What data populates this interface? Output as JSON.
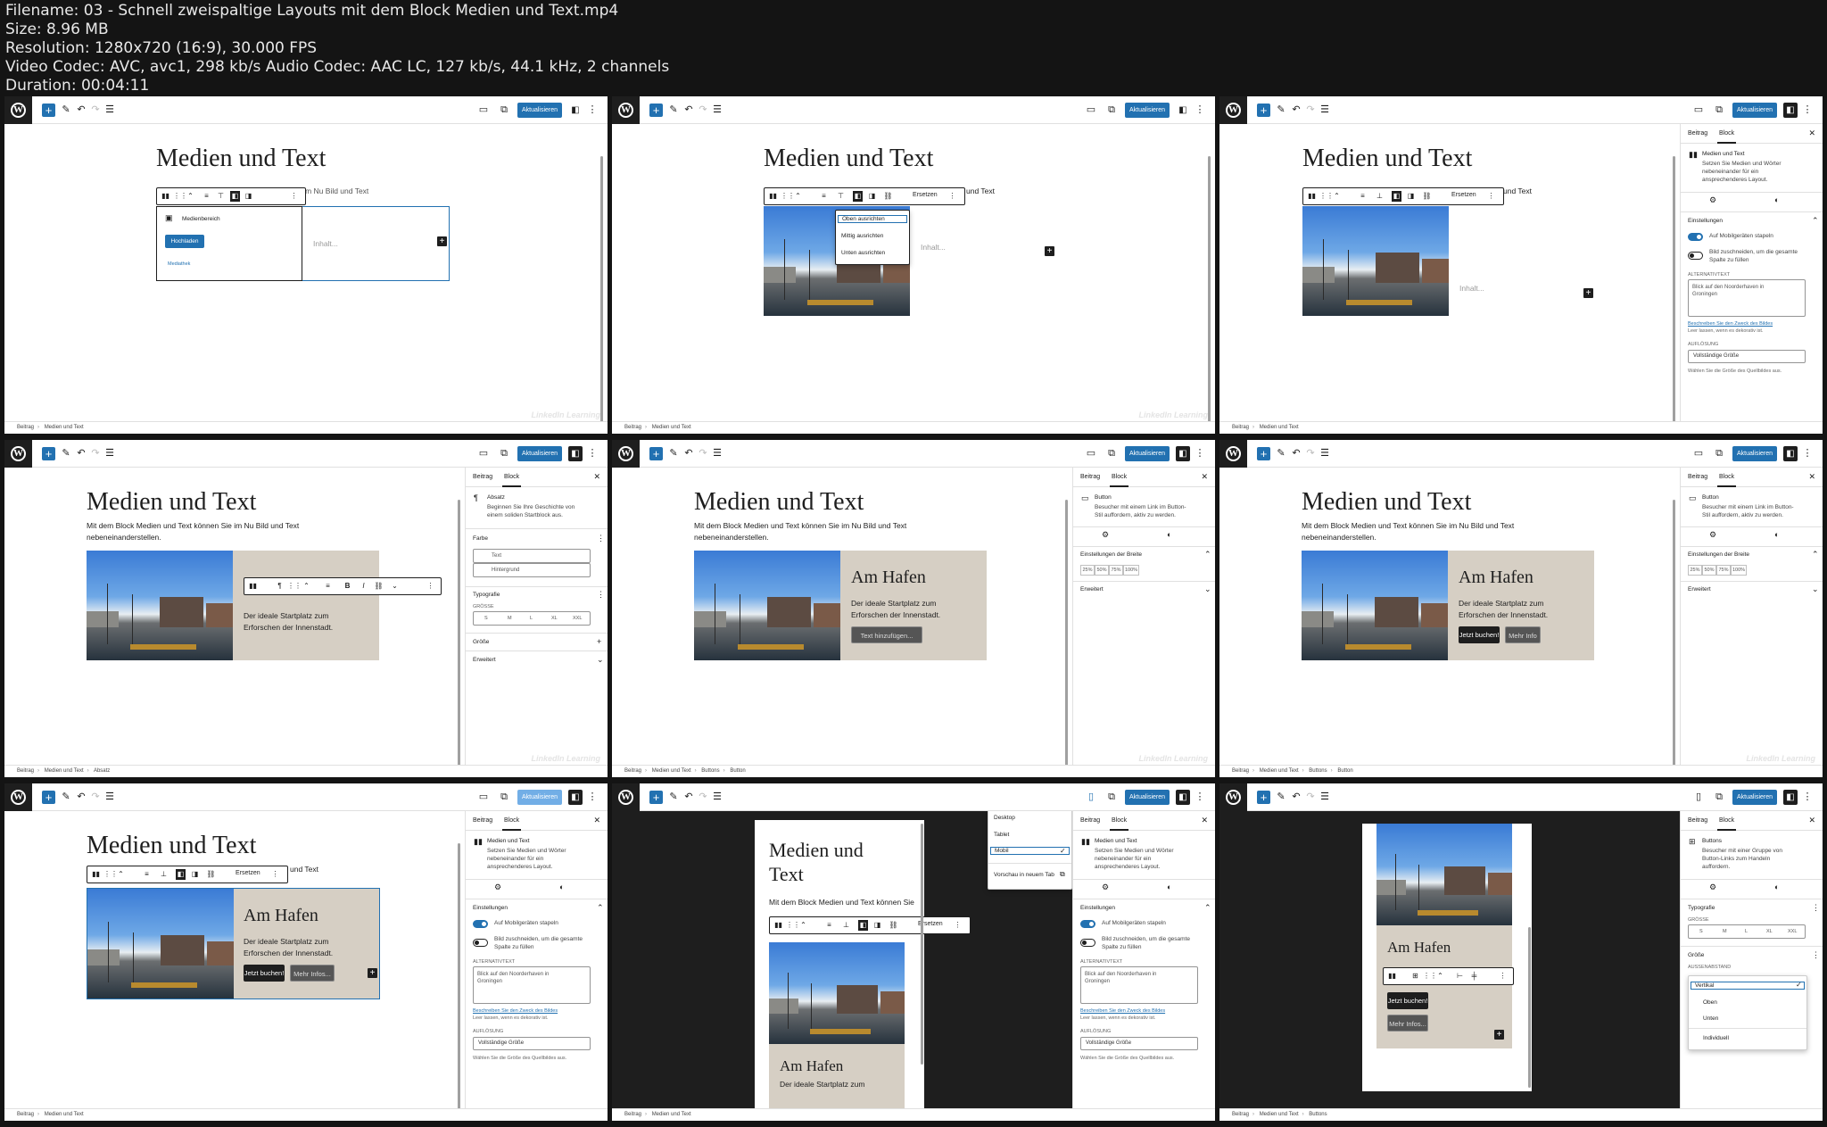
{
  "header": {
    "filename": "Filename: 03 - Schnell zweispaltige Layouts mit dem Block Medien und Text.mp4",
    "size": "Size: 8.96 MB",
    "resolution": "Resolution: 1280x720 (16:9), 30.000 FPS",
    "video": "Video Codec: AVC, avc1, 298 kb/s Audio Codec: AAC LC, 127 kb/s, 44.1 kHz, 2 channels",
    "duration": "Duration: 00:04:11"
  },
  "common": {
    "update_label": "Aktualisieren",
    "page_title": "Medien und Text",
    "page_title_split_1": "Medien und",
    "page_title_split_2": "Text",
    "intro_line1": "Mit dem Block Medien und Text können Sie im Nu Bild und Text",
    "intro_line2": "nebeneinanderstellen.",
    "intro_tail": "und Text",
    "heading_block": "Am Hafen",
    "lead_line1": "Der ideale Startplatz zum",
    "lead_line2": "Erforschen der Innenstadt.",
    "btn_book": "Jetzt buchen!",
    "btn_more": "Mehr Infos...",
    "btn_more_short": "Mehr Info",
    "btn_add_text": "Text hinzufügen...",
    "replace_label": "Ersetzen",
    "content_placeholder": "Inhalt...",
    "watermark": "LinkedIn Learning",
    "tab_post": "Beitrag",
    "tab_block": "Block",
    "media_area_label": "Medienbereich",
    "upload_label": "Hochladen",
    "library_label": "Mediathek",
    "align_top": "Oben ausrichten",
    "align_center": "Mittig ausrichten",
    "align_bottom": "Unten ausrichten"
  },
  "breadcrumbs": {
    "p1": [
      "Beitrag",
      "Medien und Text"
    ],
    "p4": [
      "Beitrag",
      "Medien und Text",
      "Absatz"
    ],
    "p5": [
      "Beitrag",
      "Medien und Text",
      "Buttons",
      "Button"
    ],
    "p9": [
      "Beitrag",
      "Medien und Text",
      "Buttons"
    ]
  },
  "sidebar_media": {
    "block_name": "Medien und Text",
    "block_desc": [
      "Setzen Sie Medien und Wörter",
      "nebeneinander für ein",
      "ansprechenderes Layout."
    ],
    "settings": "Einstellungen",
    "stack_mobile": "Auf Mobilgeräten stapeln",
    "crop_line1": "Bild zuschneiden, um die gesamte",
    "crop_line2": "Spalte zu füllen",
    "alt_label": "ALTERNATIVTEXT",
    "alt_value_1": "Blick auf den Noorderhaven in",
    "alt_value_2": "Groningen",
    "alt_link": "Beschreiben Sie den Zweck des Bildes",
    "alt_hint": "Leer lassen, wenn es dekorativ ist.",
    "resolution_label": "AUFLÖSUNG",
    "resolution_value": "Vollständige Größe",
    "resolution_hint": "Wählen Sie die Größe des Quellbildes aus."
  },
  "sidebar_paragraph": {
    "block_name": "Absatz",
    "block_desc": [
      "Beginnen Sie Ihre Geschichte von",
      "einem soliden Startblock aus."
    ],
    "color": "Farbe",
    "color_text": "Text",
    "color_bg": "Hintergrund",
    "typography": "Typografie",
    "size_label": "GRÖSSE",
    "sizes": [
      "S",
      "M",
      "L",
      "XL",
      "XXL"
    ],
    "size_section": "Größe",
    "advanced": "Erweitert"
  },
  "sidebar_button": {
    "block_name": "Button",
    "block_desc": [
      "Besucher mit einem Link im Button-",
      "Stil auffordern, aktiv zu werden."
    ],
    "width_settings": "Einstellungen der Breite",
    "widths": [
      "25%",
      "50%",
      "75%",
      "100%"
    ],
    "advanced": "Erweitert"
  },
  "sidebar_buttons": {
    "block_name": "Buttons",
    "block_desc": [
      "Besucher mit einer Gruppe von",
      "Button-Links zum Handeln",
      "auffordern."
    ],
    "typography": "Typografie",
    "size_label": "GRÖSSE",
    "sizes": [
      "S",
      "M",
      "L",
      "XL",
      "XXL"
    ],
    "size_section": "Größe",
    "spacing_label": "AUSSENABSTAND",
    "spacing_options": [
      "Vertikal",
      "Oben",
      "Unten",
      "Individuell"
    ]
  },
  "preview_menu": {
    "items": [
      "Desktop",
      "Tablet",
      "Mobil"
    ],
    "new_tab": "Vorschau in neuem Tab"
  },
  "colors": {
    "accent": "#2271b1",
    "dark": "#1e1e1e",
    "beige": "#d6cfc4"
  }
}
